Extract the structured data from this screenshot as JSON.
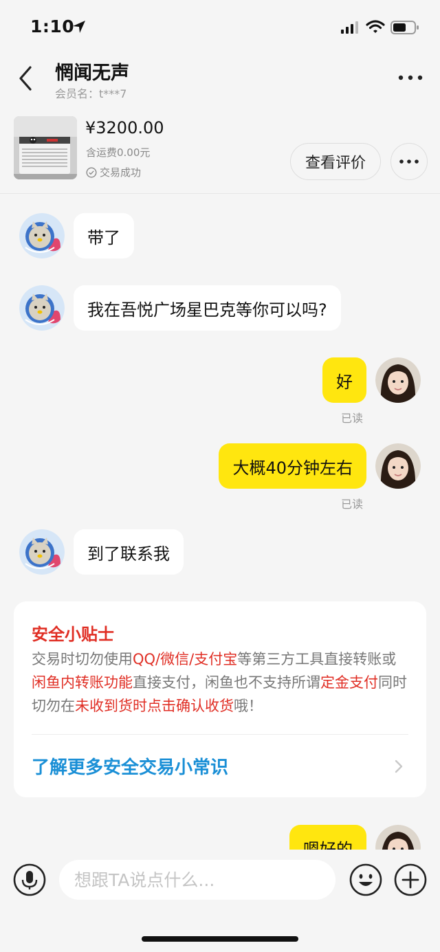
{
  "status_bar": {
    "time": "1:10"
  },
  "header": {
    "title": "惘闻无声",
    "member_label": "会员名：t***7"
  },
  "product": {
    "price": "¥3200.00",
    "shipping": "含运费0.00元",
    "status": "交易成功",
    "review_button": "查看评价"
  },
  "messages": [
    {
      "from": "other",
      "text": "带了"
    },
    {
      "from": "other",
      "text": "我在吾悦广场星巴克等你可以吗?"
    },
    {
      "from": "me",
      "text": "好",
      "read": "已读"
    },
    {
      "from": "me",
      "text": "大概40分钟左右",
      "read": "已读"
    },
    {
      "from": "other",
      "text": "到了联系我"
    },
    {
      "from": "me",
      "text": "嗯好的"
    }
  ],
  "safety_tip": {
    "title": "安全小贴士",
    "segments": [
      {
        "text": "交易时切勿使用",
        "red": false
      },
      {
        "text": "QQ/微信/支付宝",
        "red": true
      },
      {
        "text": "等第三方工具直接转账或",
        "red": false
      },
      {
        "text": "闲鱼内转账功能",
        "red": true
      },
      {
        "text": "直接支付，闲鱼也不支持所谓",
        "red": false
      },
      {
        "text": "定金支付",
        "red": true
      },
      {
        "text": "同时切勿在",
        "red": false
      },
      {
        "text": "未收到货时点击确认收货",
        "red": true
      },
      {
        "text": "哦！",
        "red": false
      }
    ],
    "link": "了解更多安全交易小常识"
  },
  "input": {
    "placeholder": "想跟TA说点什么..."
  },
  "colors": {
    "accent_yellow": "#ffe60f",
    "warning_red": "#e02e24",
    "link_blue": "#1a8fd6"
  }
}
